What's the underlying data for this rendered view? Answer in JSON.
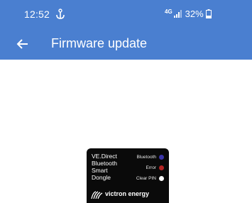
{
  "status_bar": {
    "time": "12:52",
    "network_type": "4G",
    "battery_percent": "32%",
    "notification_icon": "anchor-icon",
    "signal_icon": "signal-icon",
    "battery_icon": "battery-icon"
  },
  "app_bar": {
    "title": "Firmware update",
    "back_icon": "arrow-left-icon"
  },
  "device": {
    "name_lines": [
      "VE.Direct",
      "Bluetooth",
      "Smart",
      "Dongle"
    ],
    "leds": [
      {
        "label": "Bluetooth",
        "color": "#3b35a8"
      },
      {
        "label": "Error",
        "color": "#b32424"
      },
      {
        "label": "Clear PIN",
        "color": "#ffffff"
      }
    ],
    "brand": "victron energy"
  },
  "colors": {
    "app_bar": "#4a7fd0",
    "background": "#ffffff",
    "device_body": "#0a0a0a"
  }
}
